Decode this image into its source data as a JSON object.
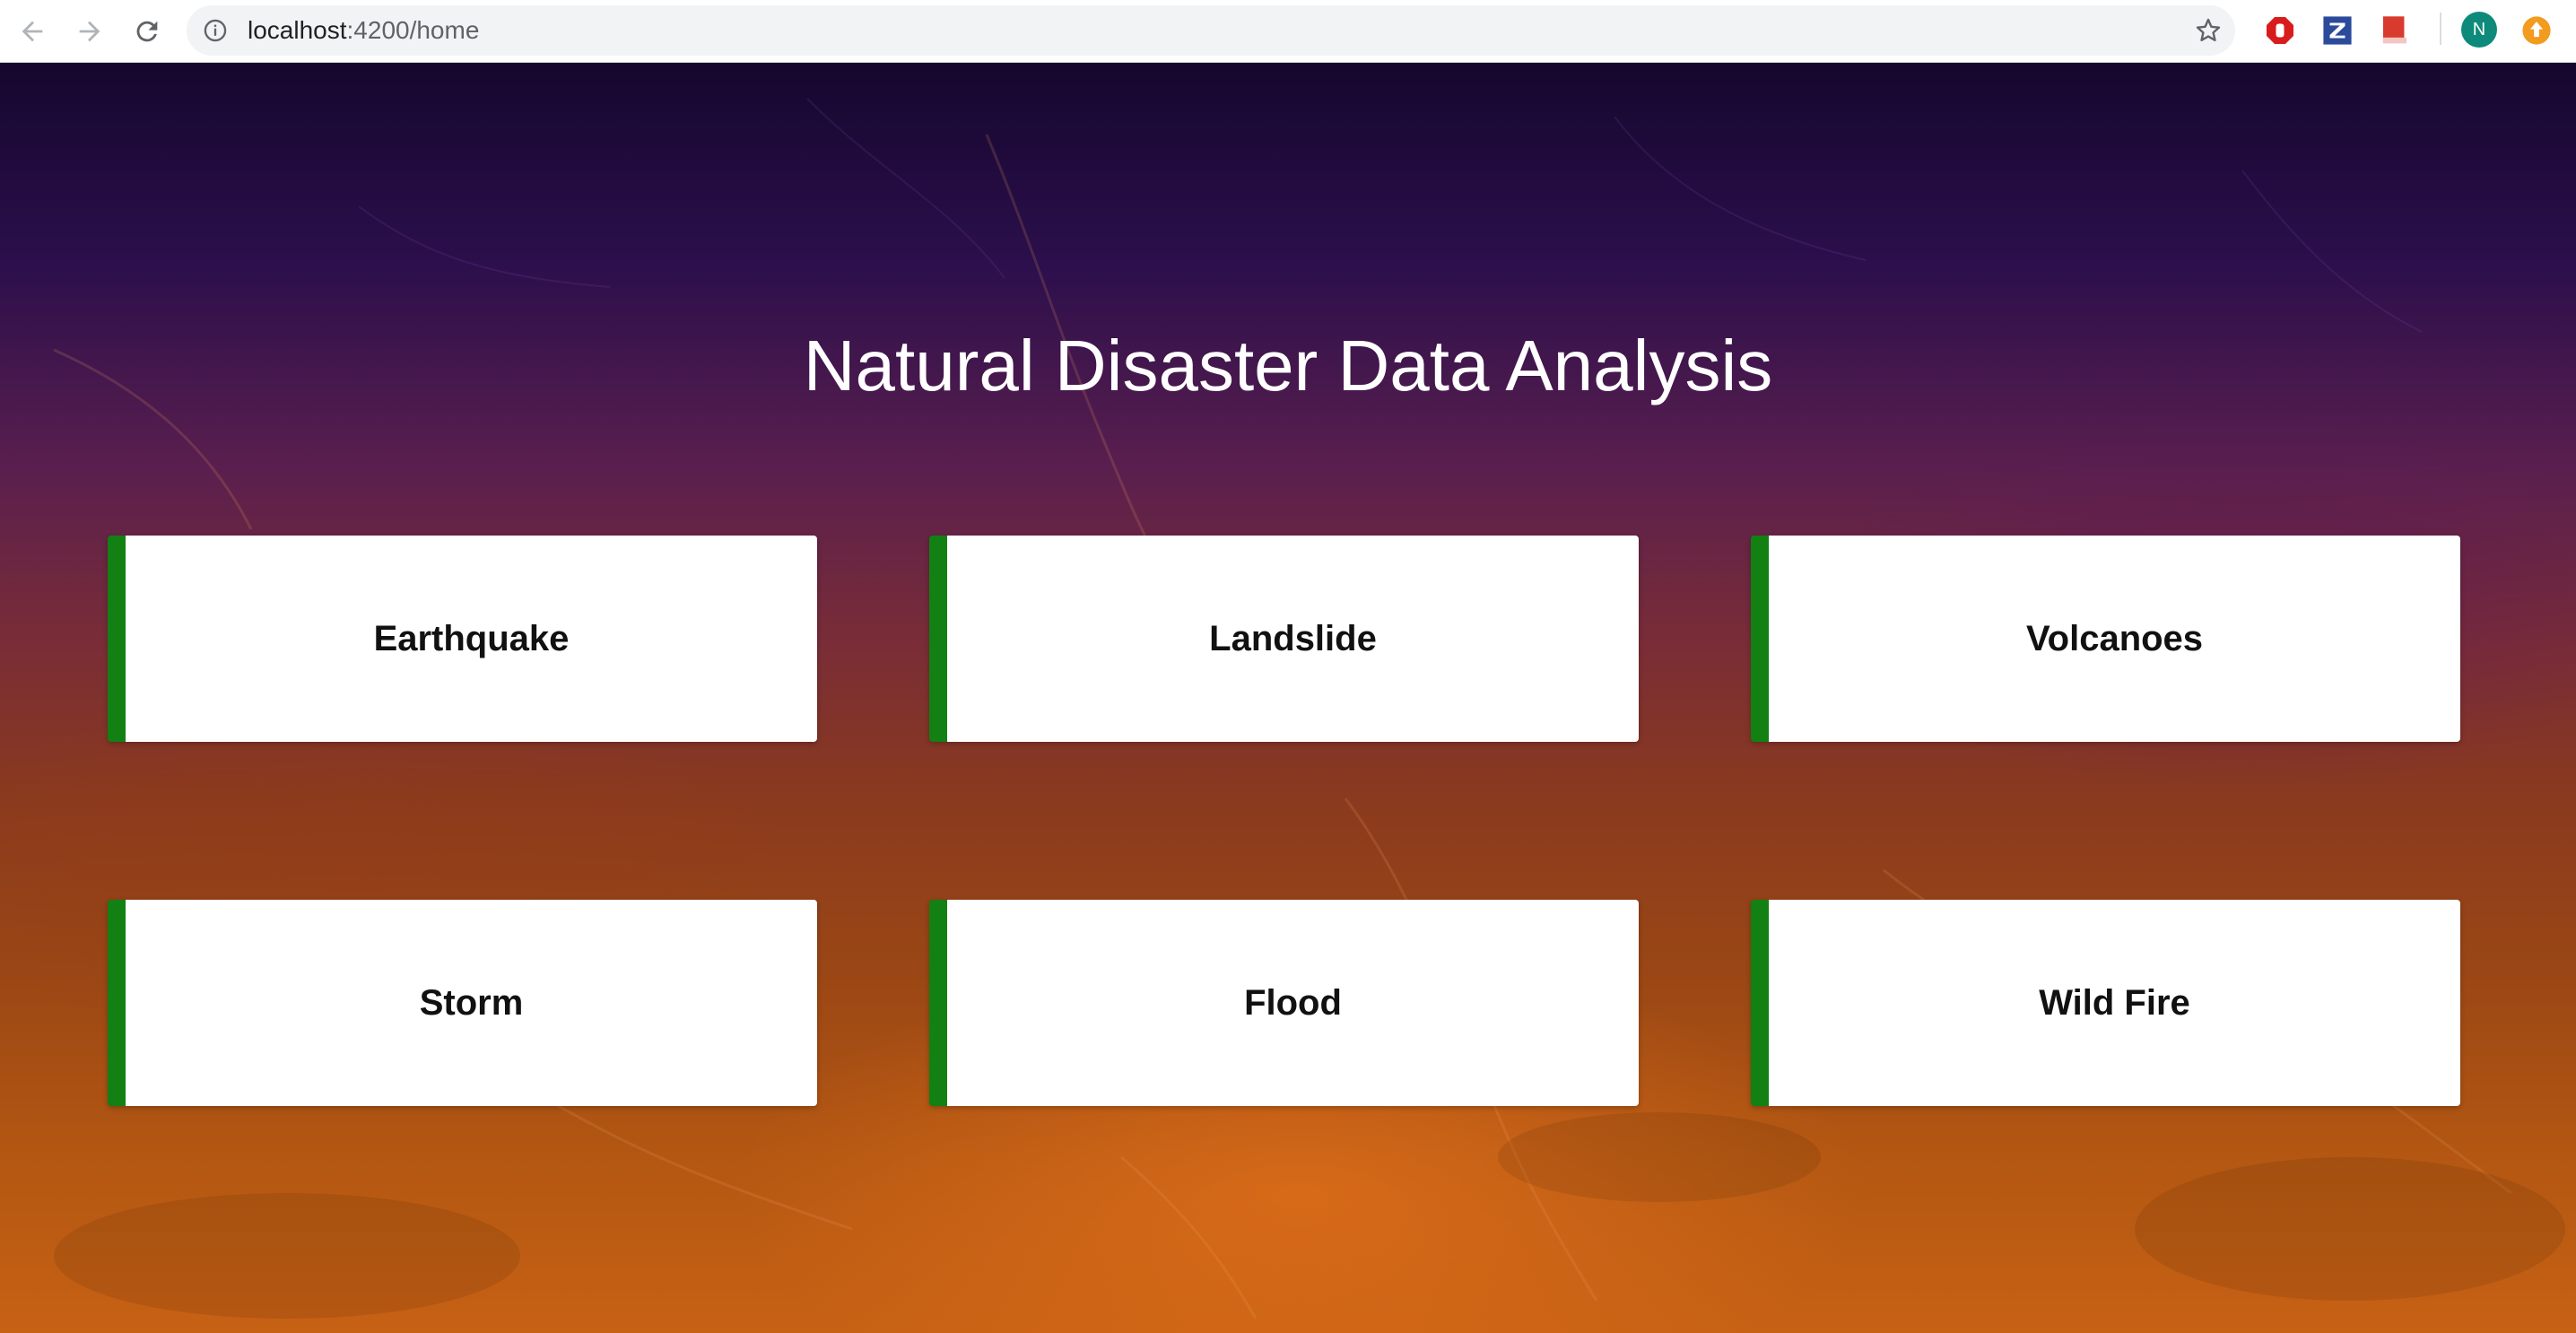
{
  "browser": {
    "url_host": "localhost",
    "url_path": ":4200/home",
    "avatar_letter": "N"
  },
  "page": {
    "title": "Natural Disaster Data Analysis",
    "cards": [
      {
        "label": "Earthquake"
      },
      {
        "label": "Landslide"
      },
      {
        "label": "Volcanoes"
      },
      {
        "label": "Storm"
      },
      {
        "label": "Flood"
      },
      {
        "label": "Wild Fire"
      }
    ]
  },
  "colors": {
    "card_accent": "#128012",
    "background_top": "#15072e",
    "background_bottom": "#c76114"
  },
  "icons": [
    "back-icon",
    "forward-icon",
    "reload-icon",
    "info-icon",
    "bookmark-star-icon",
    "adblock-icon",
    "zotero-icon",
    "bookmark-extension-icon",
    "profile-avatar",
    "update-icon"
  ]
}
